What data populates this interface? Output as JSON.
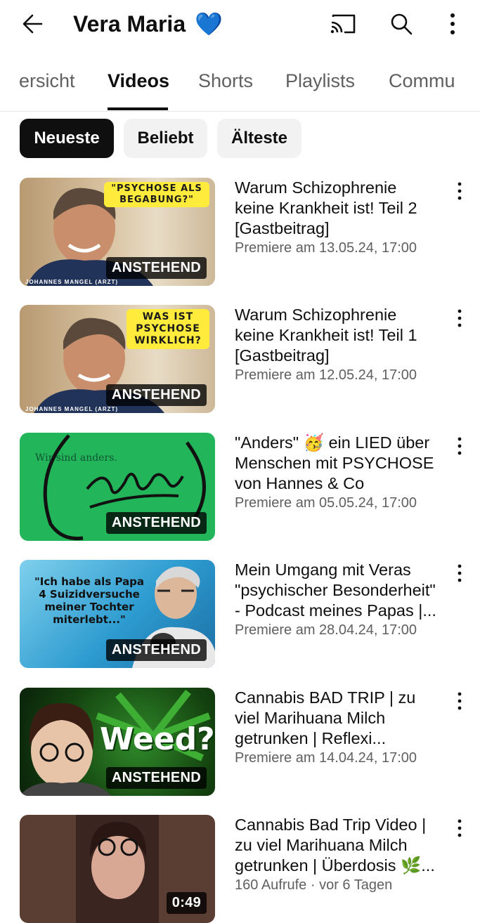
{
  "header": {
    "title": "Vera Maria",
    "title_emoji": "💙",
    "icons": [
      "back-arrow-icon",
      "cast-icon",
      "search-icon",
      "more-vertical-icon"
    ]
  },
  "tabs": [
    "ersicht",
    "Videos",
    "Shorts",
    "Playlists",
    "Commu"
  ],
  "active_tab": "Videos",
  "chips": [
    "Neueste",
    "Beliebt",
    "Älteste"
  ],
  "active_chip": "Neueste",
  "videos": [
    {
      "title": "Warum Schizophrenie keine Krankheit ist! Teil 2 [Gastbeitrag]",
      "meta": "Premiere am 13.05.24, 17:00",
      "badge": "ANSTEHEND",
      "thumb_text": "\"PSYCHOSE ALS BEGABUNG?\"",
      "thumb_caption": "JOHANNES MANGEL (ARZT)"
    },
    {
      "title": "Warum Schizophrenie keine Krankheit ist! Teil 1 [Gastbeitrag]",
      "meta": "Premiere am 12.05.24, 17:00",
      "badge": "ANSTEHEND",
      "thumb_text": "WAS IST PSYCHOSE WIRKLICH?",
      "thumb_caption": "JOHANNES MANGEL (ARZT)"
    },
    {
      "title": "\"Anders\" 🥳 ein LIED über Menschen mit PSYCHOSE von Hannes & Co",
      "meta": "Premiere am 05.05.24, 17:00",
      "badge": "ANSTEHEND",
      "thumb_text": "Wir sind anders."
    },
    {
      "title": "Mein Umgang mit Veras \"psychischer Besonderheit\" - Podcast meines Papas |...",
      "meta": "Premiere am 28.04.24, 17:00",
      "badge": "ANSTEHEND",
      "thumb_text": "\"Ich habe als Papa 4 Suizidversuche meiner Tochter miterlebt...\""
    },
    {
      "title": "Cannabis BAD TRIP | zu viel Marihuana Milch getrunken | Reflexi...",
      "meta": "Premiere am 14.04.24, 17:00",
      "badge": "ANSTEHEND",
      "thumb_text": "Weed?"
    },
    {
      "title": "Cannabis Bad Trip Video | zu viel Marihuana Milch getrunken | Überdosis 🌿...",
      "meta": "160 Aufrufe · vor 6 Tagen",
      "badge": "0:49"
    }
  ],
  "colors": {
    "text_primary": "#0f0f0f",
    "text_secondary": "#606060",
    "chip_bg": "#f2f2f2",
    "chip_selected_bg": "#0f0f0f",
    "thumb_yellow": "#ffeb3b",
    "thumb_green": "#22b55a"
  }
}
